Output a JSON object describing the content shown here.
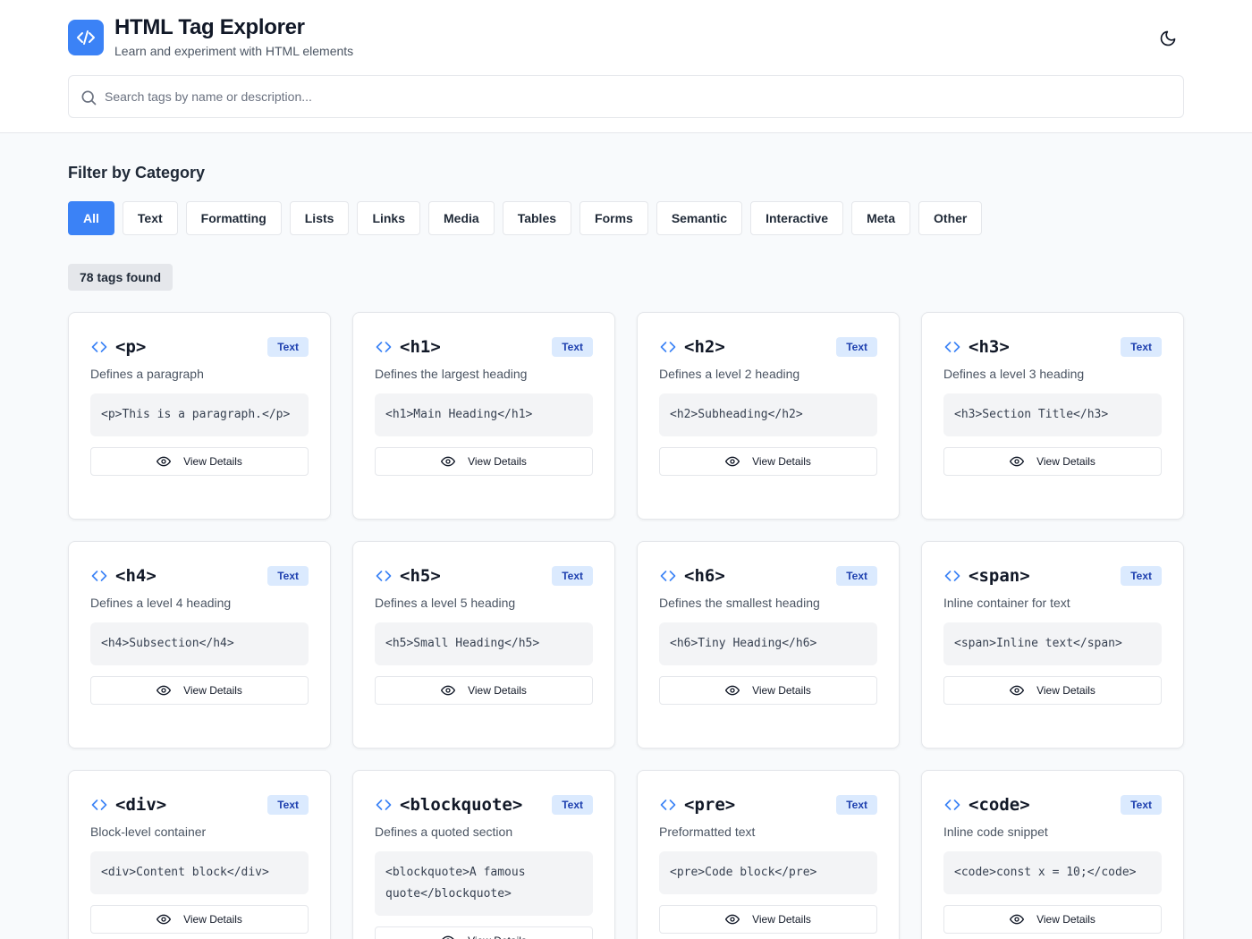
{
  "header": {
    "title": "HTML Tag Explorer",
    "subtitle": "Learn and experiment with HTML elements",
    "logo_icon": "code-icon",
    "theme_icon": "moon-icon"
  },
  "search": {
    "placeholder": "Search tags by name or description...",
    "value": ""
  },
  "filter": {
    "title": "Filter by Category",
    "categories": [
      "All",
      "Text",
      "Formatting",
      "Lists",
      "Links",
      "Media",
      "Tables",
      "Forms",
      "Semantic",
      "Interactive",
      "Meta",
      "Other"
    ],
    "active": "All"
  },
  "results": {
    "count_label": "78 tags found"
  },
  "card_common": {
    "view_label": "View Details",
    "view_icon": "eye-icon",
    "tag_icon": "code-brackets-icon"
  },
  "tags": [
    {
      "name": "<p>",
      "category": "Text",
      "description": "Defines a paragraph",
      "example": "<p>This is a paragraph.</p>"
    },
    {
      "name": "<h1>",
      "category": "Text",
      "description": "Defines the largest heading",
      "example": "<h1>Main Heading</h1>"
    },
    {
      "name": "<h2>",
      "category": "Text",
      "description": "Defines a level 2 heading",
      "example": "<h2>Subheading</h2>"
    },
    {
      "name": "<h3>",
      "category": "Text",
      "description": "Defines a level 3 heading",
      "example": "<h3>Section Title</h3>"
    },
    {
      "name": "<h4>",
      "category": "Text",
      "description": "Defines a level 4 heading",
      "example": "<h4>Subsection</h4>"
    },
    {
      "name": "<h5>",
      "category": "Text",
      "description": "Defines a level 5 heading",
      "example": "<h5>Small Heading</h5>"
    },
    {
      "name": "<h6>",
      "category": "Text",
      "description": "Defines the smallest heading",
      "example": "<h6>Tiny Heading</h6>"
    },
    {
      "name": "<span>",
      "category": "Text",
      "description": "Inline container for text",
      "example": "<span>Inline text</span>"
    },
    {
      "name": "<div>",
      "category": "Text",
      "description": "Block-level container",
      "example": "<div>Content block</div>"
    },
    {
      "name": "<blockquote>",
      "category": "Text",
      "description": "Defines a quoted section",
      "example": "<blockquote>A famous quote</blockquote>"
    },
    {
      "name": "<pre>",
      "category": "Text",
      "description": "Preformatted text",
      "example": "<pre>Code block</pre>"
    },
    {
      "name": "<code>",
      "category": "Text",
      "description": "Inline code snippet",
      "example": "<code>const x = 10;</code>"
    }
  ],
  "colors": {
    "accent": "#3b82f6",
    "badge_bg": "#dbeafe",
    "badge_text": "#1e40af"
  }
}
